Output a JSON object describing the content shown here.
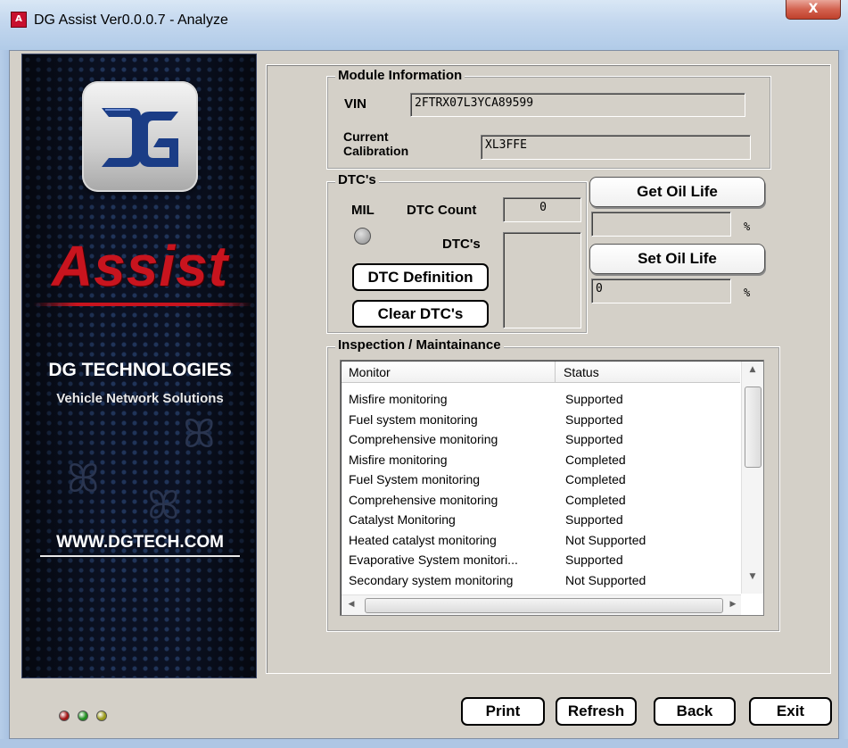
{
  "window": {
    "title": "DG Assist Ver0.0.0.7 - Analyze",
    "close_glyph": "X",
    "app_icon": "dg-app-icon"
  },
  "banner": {
    "product": "Assist",
    "company": "DG TECHNOLOGIES",
    "tagline": "Vehicle Network Solutions",
    "url": "WWW.DGTECH.COM"
  },
  "module_info": {
    "legend": "Module Information",
    "vin_label": "VIN",
    "vin_value": "2FTRX07L3YCA89599",
    "calibration_label_line1": "Current",
    "calibration_label_line2": "Calibration",
    "calibration_value": "XL3FFE"
  },
  "dtcs": {
    "legend": "DTC's",
    "mil_label": "MIL",
    "count_label": "DTC Count",
    "count_value": "0",
    "list_label": "DTC's",
    "definition_button": "DTC Definition",
    "clear_button": "Clear DTC's"
  },
  "oil_life": {
    "get_button": "Get Oil Life",
    "get_value": "",
    "set_button": "Set Oil Life",
    "set_value": "0",
    "unit": "%"
  },
  "inspection": {
    "legend": "Inspection / Maintainance",
    "columns": [
      "Monitor",
      "Status"
    ],
    "rows": [
      {
        "monitor": "Misfire monitoring",
        "status": "Supported"
      },
      {
        "monitor": "Fuel system monitoring",
        "status": "Supported"
      },
      {
        "monitor": "Comprehensive monitoring",
        "status": "Supported"
      },
      {
        "monitor": "Misfire monitoring",
        "status": "Completed"
      },
      {
        "monitor": "Fuel System monitoring",
        "status": "Completed"
      },
      {
        "monitor": "Comprehensive monitoring",
        "status": "Completed"
      },
      {
        "monitor": "Catalyst Monitoring",
        "status": "Supported"
      },
      {
        "monitor": "Heated catalyst monitoring",
        "status": "Not Supported"
      },
      {
        "monitor": "Evaporative System monitori...",
        "status": "Supported"
      },
      {
        "monitor": "Secondary system monitoring",
        "status": "Not Supported"
      }
    ]
  },
  "footer": {
    "print": "Print",
    "refresh": "Refresh",
    "back": "Back",
    "exit": "Exit",
    "status_colors": [
      "#a31515",
      "#1f8f1f",
      "#9a9a1a"
    ]
  }
}
